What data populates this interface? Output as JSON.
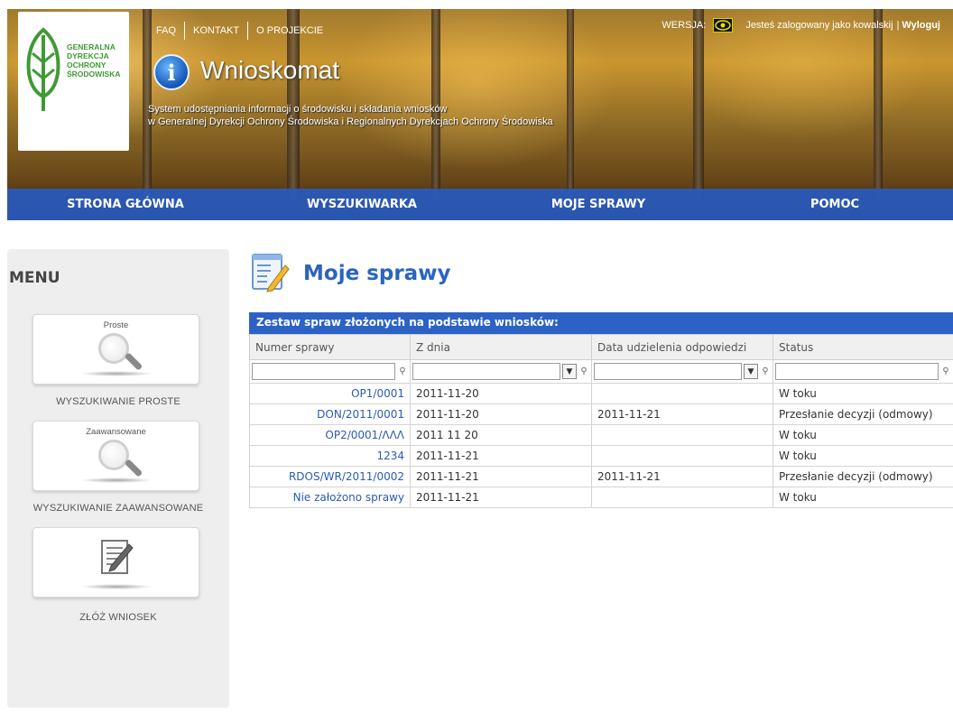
{
  "header": {
    "logo_text": [
      "GENERALNA",
      "DYREKCJA",
      "OCHRONY",
      "ŚRODOWISKA"
    ],
    "top_links": [
      "FAQ",
      "KONTAKT",
      "O PROJEKCIE"
    ],
    "version_label": "WERSJA:",
    "logged_in_text": "Jesteś zalogowany jako kowalskij",
    "logged_sep": "|",
    "logout_label": "Wyloguj",
    "info_glyph": "i",
    "app_title": "Wnioskomat",
    "subtitle_line1": "System udostępniania informacji o środowisku i składania wniosków",
    "subtitle_line2": "w Generalnej Dyrekcji Ochrony Środowiska i Regionalnych Dyrekcjach Ochrony Środowiska"
  },
  "nav": {
    "items": [
      "STRONA GŁÓWNA",
      "WYSZUKIWARKA",
      "MOJE SPRAWY",
      "POMOC"
    ]
  },
  "sidebar": {
    "title": "MENU",
    "tiles": [
      {
        "label": "Proste",
        "caption": "WYSZUKIWANIE PROSTE",
        "icon": "magnifier-icon"
      },
      {
        "label": "Zaawansowane",
        "caption": "WYSZUKIWANIE ZAAWANSOWANE",
        "icon": "magnifier-icon"
      },
      {
        "label": "",
        "caption": "ZŁÓŻ WNIOSEK",
        "icon": "form-edit-icon"
      }
    ]
  },
  "main": {
    "title": "Moje sprawy",
    "table_caption": "Zestaw spraw złożonych na podstawie wniosków:",
    "columns": [
      "Numer sprawy",
      "Z dnia",
      "Data udzielenia odpowiedzi",
      "Status"
    ],
    "rows": [
      {
        "numer": "OP1/0001",
        "z_dnia": "2011-11-20",
        "data_odp": "",
        "status": "W toku"
      },
      {
        "numer": "DON/2011/0001",
        "z_dnia": "2011-11-20",
        "data_odp": "2011-11-21",
        "status": "Przesłanie decyzji (odmowy)"
      },
      {
        "numer": "OP2/0001/ΛΛΛ",
        "z_dnia": "2011 11 20",
        "data_odp": "",
        "status": "W toku"
      },
      {
        "numer": "1234",
        "z_dnia": "2011-11-21",
        "data_odp": "",
        "status": "W toku"
      },
      {
        "numer": "RDOS/WR/2011/0002",
        "z_dnia": "2011-11-21",
        "data_odp": "2011-11-21",
        "status": "Przesłanie decyzji (odmowy)"
      },
      {
        "numer": "Nie założono sprawy",
        "z_dnia": "2011-11-21",
        "data_odp": "",
        "status": "W toku"
      }
    ]
  },
  "colors": {
    "nav_bg": "#2c5fc0",
    "title_blue": "#2a64bf",
    "link_blue": "#2a5ab8",
    "logo_green": "#3f9a34"
  }
}
